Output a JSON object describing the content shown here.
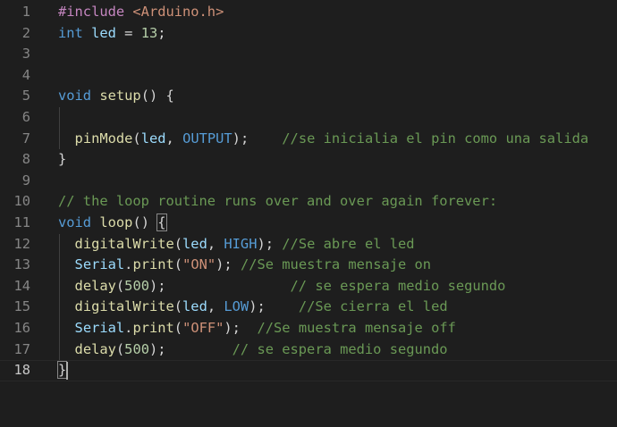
{
  "editor": {
    "language": "Arduino C++",
    "theme": "dark",
    "active_line": 18,
    "colors": {
      "background": "#1e1e1e",
      "keyword": "#569cd6",
      "preprocessor": "#c586c0",
      "string": "#ce9178",
      "number": "#b5cea8",
      "function": "#dcdcaa",
      "variable": "#9cdcfe",
      "class": "#4ec9b0",
      "constant": "#4fc1ff",
      "comment": "#6a9955",
      "line_number": "#858585"
    },
    "line_numbers": [
      "1",
      "2",
      "3",
      "4",
      "5",
      "6",
      "7",
      "8",
      "9",
      "10",
      "11",
      "12",
      "13",
      "14",
      "15",
      "16",
      "17",
      "18"
    ],
    "lines": [
      [
        {
          "t": "#include ",
          "c": "pre"
        },
        {
          "t": "<Arduino.h>",
          "c": "str"
        }
      ],
      [
        {
          "t": "int",
          "c": "kw"
        },
        {
          "t": " led",
          "c": "var"
        },
        {
          "t": " = ",
          "c": "pun"
        },
        {
          "t": "13",
          "c": "num"
        },
        {
          "t": ";",
          "c": "pun"
        }
      ],
      [],
      [],
      [
        {
          "t": "void",
          "c": "kw"
        },
        {
          "t": " ",
          "c": "pun"
        },
        {
          "t": "setup",
          "c": "fn"
        },
        {
          "t": "() {",
          "c": "pun"
        }
      ],
      [],
      [
        {
          "t": "  ",
          "c": "pun"
        },
        {
          "t": "pinMode",
          "c": "fn"
        },
        {
          "t": "(",
          "c": "pun"
        },
        {
          "t": "led",
          "c": "var"
        },
        {
          "t": ", ",
          "c": "pun"
        },
        {
          "t": "OUTPUT",
          "c": "kw"
        },
        {
          "t": ");    ",
          "c": "pun"
        },
        {
          "t": "//se inicialia el pin como una salida",
          "c": "cmt"
        }
      ],
      [
        {
          "t": "}",
          "c": "pun"
        }
      ],
      [],
      [
        {
          "t": "// the loop routine runs over and over again forever:",
          "c": "cmt"
        }
      ],
      [
        {
          "t": "void",
          "c": "kw"
        },
        {
          "t": " ",
          "c": "pun"
        },
        {
          "t": "loop",
          "c": "fn"
        },
        {
          "t": "() ",
          "c": "pun"
        },
        {
          "t": "{",
          "c": "bm"
        }
      ],
      [
        {
          "t": "  ",
          "c": "pun"
        },
        {
          "t": "digitalWrite",
          "c": "fn"
        },
        {
          "t": "(",
          "c": "pun"
        },
        {
          "t": "led",
          "c": "var"
        },
        {
          "t": ", ",
          "c": "pun"
        },
        {
          "t": "HIGH",
          "c": "kw"
        },
        {
          "t": "); ",
          "c": "pun"
        },
        {
          "t": "//Se abre el led",
          "c": "cmt"
        }
      ],
      [
        {
          "t": "  ",
          "c": "pun"
        },
        {
          "t": "Serial",
          "c": "var"
        },
        {
          "t": ".",
          "c": "pun"
        },
        {
          "t": "print",
          "c": "fn"
        },
        {
          "t": "(",
          "c": "pun"
        },
        {
          "t": "\"ON\"",
          "c": "str"
        },
        {
          "t": "); ",
          "c": "pun"
        },
        {
          "t": "//Se muestra mensaje on",
          "c": "cmt"
        }
      ],
      [
        {
          "t": "  ",
          "c": "pun"
        },
        {
          "t": "delay",
          "c": "fn"
        },
        {
          "t": "(",
          "c": "pun"
        },
        {
          "t": "500",
          "c": "num"
        },
        {
          "t": ");               ",
          "c": "pun"
        },
        {
          "t": "// se espera medio segundo",
          "c": "cmt"
        }
      ],
      [
        {
          "t": "  ",
          "c": "pun"
        },
        {
          "t": "digitalWrite",
          "c": "fn"
        },
        {
          "t": "(",
          "c": "pun"
        },
        {
          "t": "led",
          "c": "var"
        },
        {
          "t": ", ",
          "c": "pun"
        },
        {
          "t": "LOW",
          "c": "kw"
        },
        {
          "t": ");    ",
          "c": "pun"
        },
        {
          "t": "//Se cierra el led",
          "c": "cmt"
        }
      ],
      [
        {
          "t": "  ",
          "c": "pun"
        },
        {
          "t": "Serial",
          "c": "var"
        },
        {
          "t": ".",
          "c": "pun"
        },
        {
          "t": "print",
          "c": "fn"
        },
        {
          "t": "(",
          "c": "pun"
        },
        {
          "t": "\"OFF\"",
          "c": "str"
        },
        {
          "t": ");  ",
          "c": "pun"
        },
        {
          "t": "//Se muestra mensaje off",
          "c": "cmt"
        }
      ],
      [
        {
          "t": "  ",
          "c": "pun"
        },
        {
          "t": "delay",
          "c": "fn"
        },
        {
          "t": "(",
          "c": "pun"
        },
        {
          "t": "500",
          "c": "num"
        },
        {
          "t": ");        ",
          "c": "pun"
        },
        {
          "t": "// se espera medio segundo",
          "c": "cmt"
        }
      ],
      [
        {
          "t": "}",
          "c": "bm"
        }
      ]
    ]
  }
}
